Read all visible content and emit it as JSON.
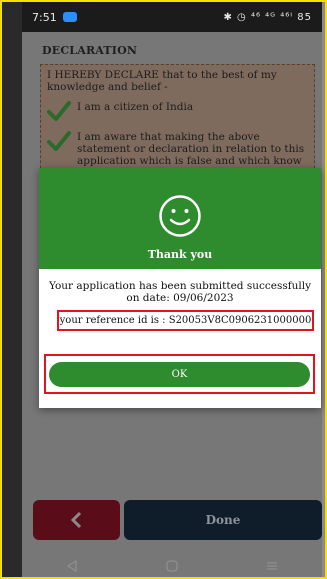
{
  "status_bar": {
    "time": "7:51",
    "right_icons": "✱ ◷ ⁴⁶ ⁴ᴳ ⁴⁶ᴵ 85"
  },
  "declaration": {
    "title": "DECLARATION",
    "intro": "I HEREBY DECLARE that to the best of my knowledge and belief -",
    "items": [
      "I am a citizen of India",
      "I am aware that making the above statement or declaration in relation to this application which is false and which know or believe to be false or do not believe to"
    ]
  },
  "modal": {
    "title": "Thank you",
    "message": "Your application has been submitted successfully on date: 09/06/2023",
    "reference": "your reference id is : S20053V8C0906231000000",
    "ok_label": "OK"
  },
  "bottom_bar": {
    "done_label": "Done"
  },
  "colors": {
    "accent_green": "#2e8b2e",
    "highlight_red": "#e0141e"
  }
}
